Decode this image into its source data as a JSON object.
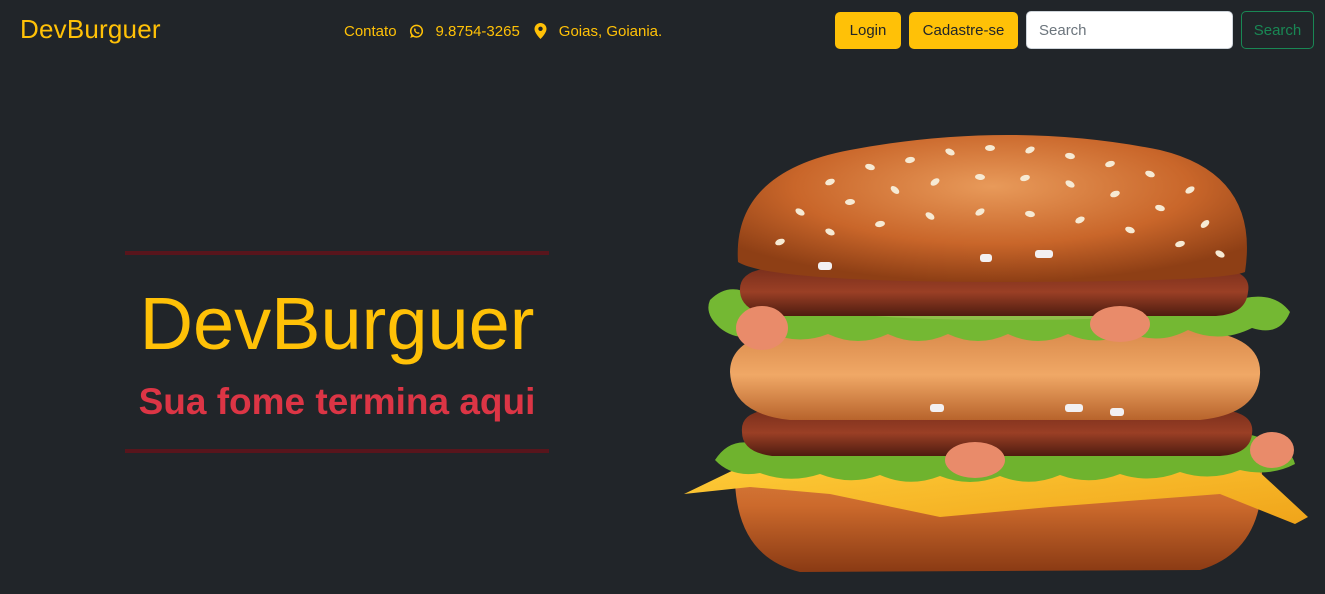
{
  "navbar": {
    "brand": "DevBurguer",
    "contact_label": "Contato",
    "phone": "9.8754-3265",
    "location": "Goias, Goiania.",
    "login_label": "Login",
    "signup_label": "Cadastre-se",
    "search_placeholder": "Search",
    "search_button_label": "Search"
  },
  "hero": {
    "title": "DevBurguer",
    "subtitle": "Sua fome termina aqui"
  },
  "colors": {
    "background": "#212529",
    "accent_yellow": "#ffc107",
    "subtitle_red": "#dc3545",
    "rule_dark_red": "#58151c",
    "search_green": "#198754"
  },
  "icons": [
    "whatsapp-icon",
    "map-pin-icon"
  ],
  "image": {
    "subject": "hamburger-image"
  }
}
